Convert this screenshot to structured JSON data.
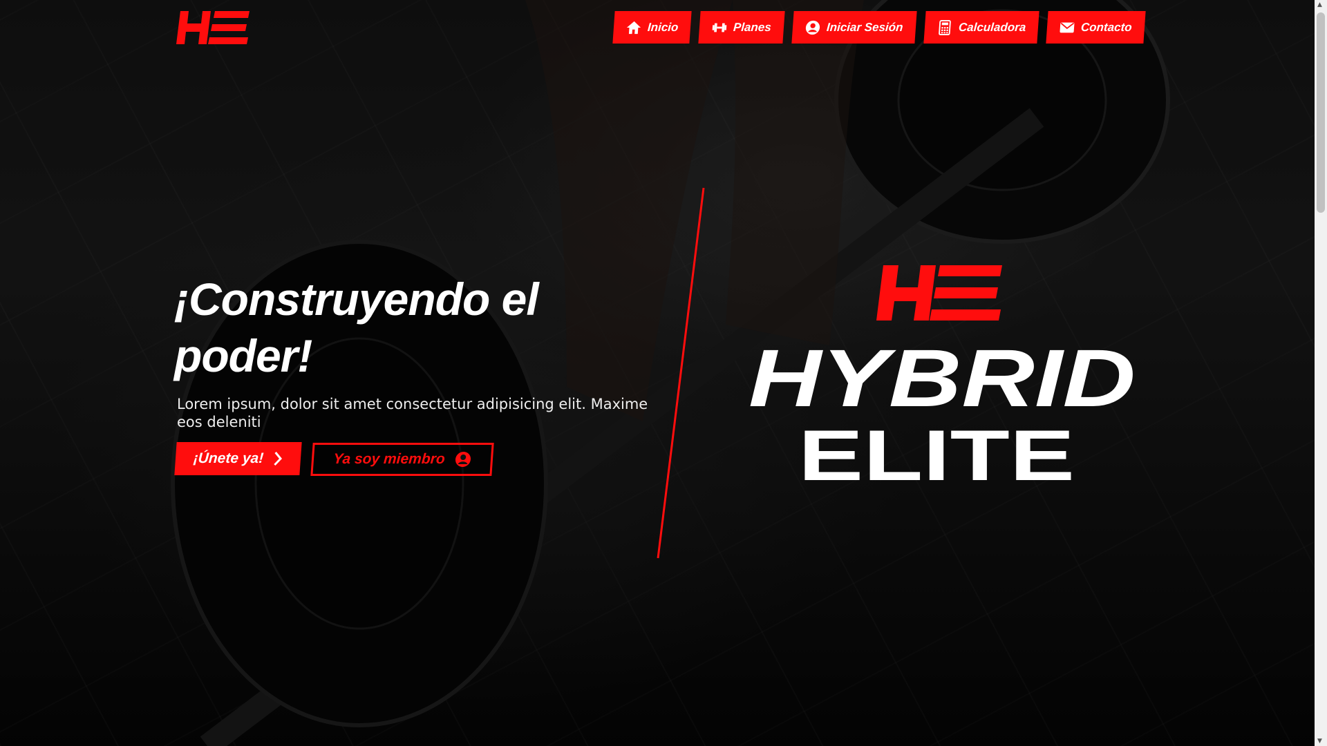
{
  "nav": {
    "items": [
      {
        "label": "Inicio",
        "icon": "home-icon"
      },
      {
        "label": "Planes",
        "icon": "dumbbell-icon"
      },
      {
        "label": "Iniciar Sesión",
        "icon": "user-circle-icon"
      },
      {
        "label": "Calculadora",
        "icon": "calculator-icon"
      },
      {
        "label": "Contacto",
        "icon": "envelope-icon"
      }
    ]
  },
  "hero": {
    "title": "¡Construyendo el poder!",
    "subtitle": "Lorem ipsum, dolor sit amet consectetur adipisicing elit. Maxime eos deleniti",
    "join_label": "¡Únete ya!",
    "member_label": "Ya soy miembro"
  },
  "brand": {
    "monogram": "HE",
    "line1": "HYBRID",
    "line2": "ELITE"
  },
  "colors": {
    "accent": "#ff0d0d",
    "text": "#ffffff",
    "background": "#111111"
  }
}
